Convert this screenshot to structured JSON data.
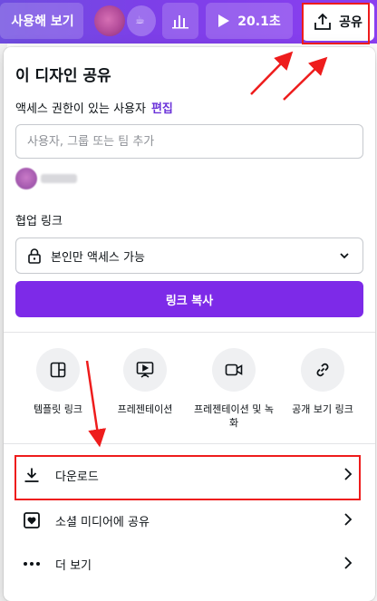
{
  "topbar": {
    "view_label": "사용해 보기",
    "timer_label": "20.1초",
    "share_label": "공유"
  },
  "share_popover": {
    "title": "이 디자인 공유",
    "access_label": "액세스 권한이 있는 사용자",
    "edit_link": "편집",
    "add_people_placeholder": "사용자, 그룹 또는 팀 추가",
    "collab_link_label": "협업 링크",
    "access_option": "본인만 액세스 가능",
    "copy_link_label": "링크 복사",
    "options": [
      {
        "label": "템플릿 링크",
        "icon": "template-icon"
      },
      {
        "label": "프레젠테이션",
        "icon": "present-icon"
      },
      {
        "label": "프레젠테이션 및 녹화",
        "icon": "record-icon"
      },
      {
        "label": "공개 보기 링크",
        "icon": "link-icon"
      }
    ],
    "rows": [
      {
        "label": "다운로드",
        "icon": "download-icon"
      },
      {
        "label": "소셜 미디어에 공유",
        "icon": "heart-icon"
      },
      {
        "label": "더 보기",
        "icon": "more-icon"
      }
    ]
  },
  "annotation_color": "#ee1c1c",
  "accent_color": "#7d2ae8"
}
